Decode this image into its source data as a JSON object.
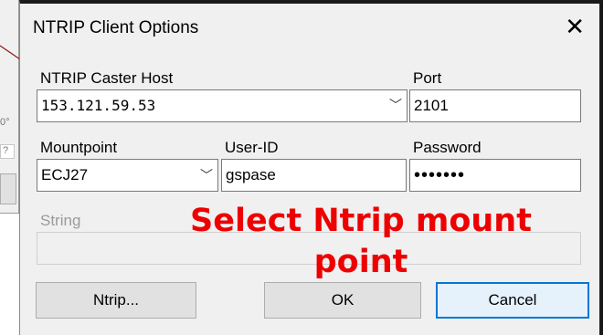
{
  "background": {
    "fragments": [
      "0°",
      "?"
    ]
  },
  "dialog": {
    "title": "NTRIP Client Options",
    "close_glyph": "✕",
    "caster_host": {
      "label": "NTRIP Caster Host",
      "value": "153.121.59.53"
    },
    "port": {
      "label": "Port",
      "value": "2101"
    },
    "mountpoint": {
      "label": "Mountpoint",
      "value": "ECJ27"
    },
    "user_id": {
      "label": "User-ID",
      "value": "gspase"
    },
    "password": {
      "label": "Password",
      "value": "•••••••"
    },
    "string": {
      "label": "String",
      "value": ""
    },
    "buttons": {
      "ntrip": "Ntrip...",
      "ok": "OK",
      "cancel": "Cancel"
    }
  },
  "annotation": {
    "text": "Select Ntrip mount point",
    "color": "#ee0000"
  },
  "colors": {
    "dialog_bg": "#f0f0f0",
    "default_button_border": "#0078d7",
    "callout_line": "#8b1a1a"
  }
}
